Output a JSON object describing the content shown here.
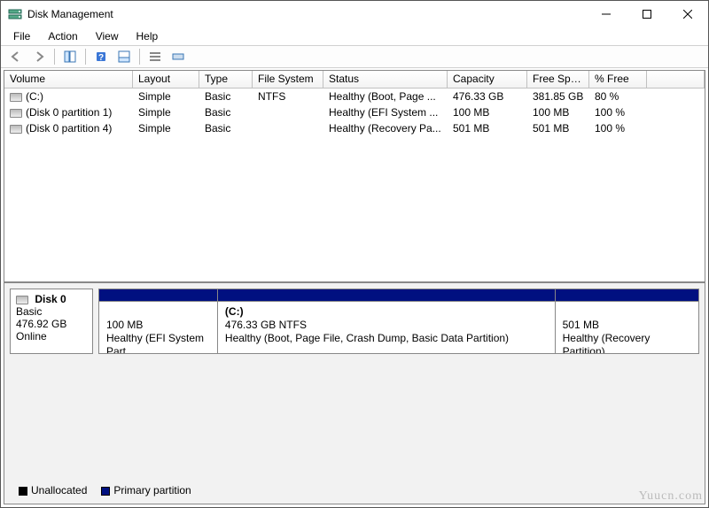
{
  "window": {
    "title": "Disk Management"
  },
  "menu": {
    "items": [
      "File",
      "Action",
      "View",
      "Help"
    ]
  },
  "toolbar": {
    "back": "back-icon",
    "forward": "forward-icon",
    "show_hide": "show-hide-icon",
    "help": "help-icon",
    "refresh": "refresh-icon",
    "list": "list-icon",
    "detail": "detail-icon"
  },
  "columns": [
    "Volume",
    "Layout",
    "Type",
    "File System",
    "Status",
    "Capacity",
    "Free Spa...",
    "% Free"
  ],
  "volumes": [
    {
      "name": "(C:)",
      "layout": "Simple",
      "type": "Basic",
      "fs": "NTFS",
      "status": "Healthy (Boot, Page ...",
      "capacity": "476.33 GB",
      "free": "381.85 GB",
      "pct": "80 %"
    },
    {
      "name": "(Disk 0 partition 1)",
      "layout": "Simple",
      "type": "Basic",
      "fs": "",
      "status": "Healthy (EFI System ...",
      "capacity": "100 MB",
      "free": "100 MB",
      "pct": "100 %"
    },
    {
      "name": "(Disk 0 partition 4)",
      "layout": "Simple",
      "type": "Basic",
      "fs": "",
      "status": "Healthy (Recovery Pa...",
      "capacity": "501 MB",
      "free": "501 MB",
      "pct": "100 %"
    }
  ],
  "disk": {
    "name": "Disk 0",
    "type": "Basic",
    "size": "476.92 GB",
    "state": "Online",
    "partitions": [
      {
        "title": "",
        "line1": "100 MB",
        "line2": "Healthy (EFI System Part",
        "flex": 14
      },
      {
        "title": "(C:)",
        "line1": "476.33 GB NTFS",
        "line2": "Healthy (Boot, Page File, Crash Dump, Basic Data Partition)",
        "flex": 40
      },
      {
        "title": "",
        "line1": "501 MB",
        "line2": "Healthy (Recovery Partition)",
        "flex": 17
      }
    ]
  },
  "legend": {
    "unallocated": "Unallocated",
    "primary": "Primary partition"
  },
  "watermark": "Yuucn.com"
}
